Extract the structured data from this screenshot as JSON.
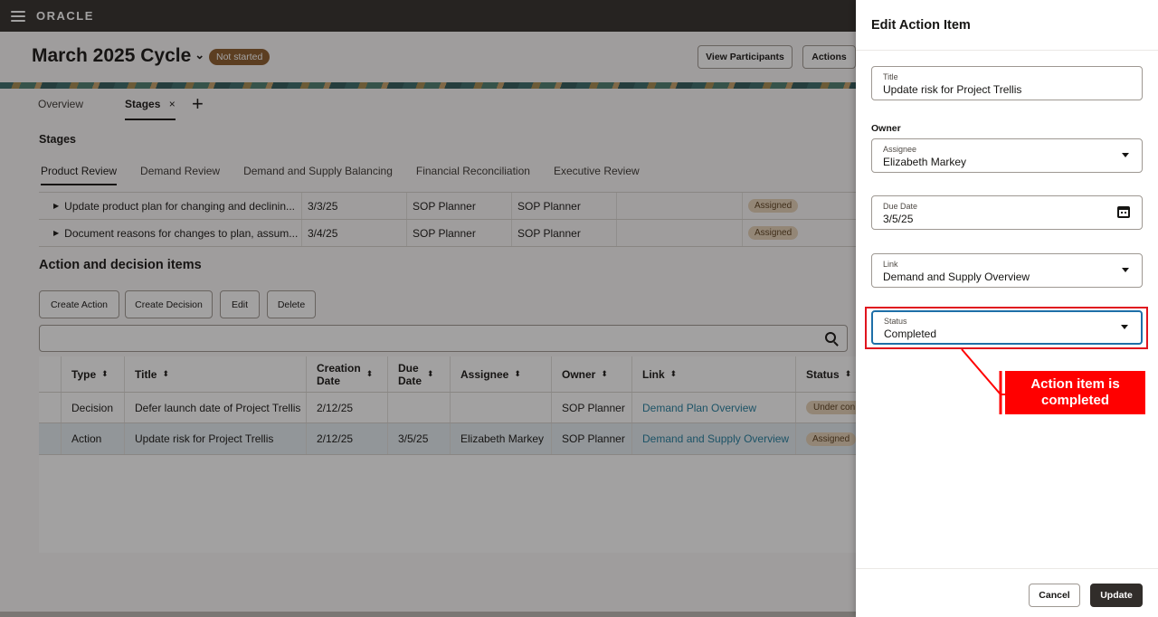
{
  "app": {
    "logo": "ORACLE"
  },
  "header": {
    "cycle_title": "March 2025 Cycle",
    "status_badge": "Not started",
    "view_participants": "View Participants",
    "actions": "Actions"
  },
  "tabs": [
    {
      "label": "Overview"
    },
    {
      "label": "Stages",
      "close": "×"
    }
  ],
  "add_tab": "+",
  "stages": {
    "label": "Stages",
    "tabs": [
      "Product Review",
      "Demand Review",
      "Demand and Supply Balancing",
      "Financial Reconciliation",
      "Executive Review"
    ],
    "rows": [
      {
        "title": "Update product plan for changing and declinin...",
        "date": "3/3/25",
        "col3": "SOP Planner",
        "col4": "SOP Planner",
        "status": "Assigned"
      },
      {
        "title": "Document reasons for changes to plan, assum...",
        "date": "3/4/25",
        "col3": "SOP Planner",
        "col4": "SOP Planner",
        "status": "Assigned"
      }
    ]
  },
  "action_items": {
    "title": "Action and decision items",
    "buttons": {
      "create_action": "Create Action",
      "create_decision": "Create Decision",
      "edit": "Edit",
      "delete": "Delete"
    },
    "columns": {
      "type": "Type",
      "title": "Title",
      "creation_date_1": "Creation",
      "creation_date_2": "Date",
      "due_date_1": "Due",
      "due_date_2": "Date",
      "assignee": "Assignee",
      "owner": "Owner",
      "link": "Link",
      "status": "Status"
    },
    "rows": [
      {
        "type": "Decision",
        "title": "Defer launch date of Project Trellis",
        "creation_date": "2/12/25",
        "due_date": "",
        "assignee": "",
        "owner": "SOP Planner",
        "link": "Demand Plan Overview",
        "status": "Under con"
      },
      {
        "type": "Action",
        "title": "Update risk for Project Trellis",
        "creation_date": "2/12/25",
        "due_date": "3/5/25",
        "assignee": "Elizabeth Markey",
        "owner": "SOP Planner",
        "link": "Demand and Supply Overview",
        "status": "Assigned"
      }
    ]
  },
  "drawer": {
    "title": "Edit Action Item",
    "fields": {
      "title_label": "Title",
      "title_value": "Update risk for Project Trellis",
      "owner_label": "Owner",
      "assignee_label": "Assignee",
      "assignee_value": "Elizabeth Markey",
      "due_date_label": "Due Date",
      "due_date_value": "3/5/25",
      "link_label": "Link",
      "link_value": "Demand and Supply Overview",
      "status_label": "Status",
      "status_value": "Completed"
    },
    "cancel": "Cancel",
    "update": "Update"
  },
  "callout": {
    "line1": "Action item is",
    "line2": "completed"
  },
  "colors": {
    "accent_red": "#ff0000",
    "link": "#227e9e",
    "topbar": "#312d2a"
  }
}
